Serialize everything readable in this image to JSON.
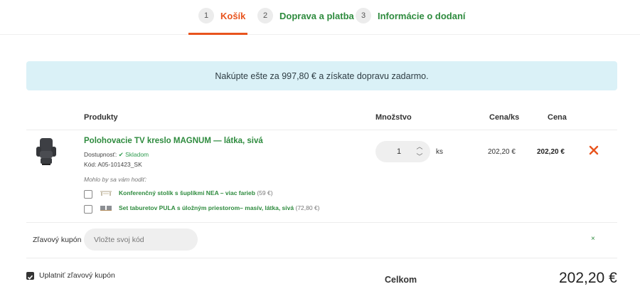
{
  "steps": [
    {
      "num": "1",
      "label": "Košík",
      "active": true
    },
    {
      "num": "2",
      "label": "Doprava a platba",
      "active": false
    },
    {
      "num": "3",
      "label": "Informácie o dodaní",
      "active": false
    }
  ],
  "banner": {
    "text": "Nakúpte ešte za 997,80 € a získate dopravu zadarmo."
  },
  "table": {
    "headers": {
      "products": "Produkty",
      "quantity": "Množstvo",
      "unit_price": "Cena/ks",
      "price": "Cena"
    }
  },
  "product": {
    "name": "Polohovacie TV kreslo MAGNUM — látka, sivá",
    "availability_label": "Dostupnosť:",
    "availability_value": "Skladom",
    "code": "Kód: A05-101423_SK",
    "quantity": "1",
    "unit": "ks",
    "unit_price": "202,20 €",
    "price": "202,20 €"
  },
  "suggestions": {
    "title": "Mohlo by sa vám hodiť:",
    "items": [
      {
        "name": "Konferenčný stolík s šuplíkmi NEA – viac farieb",
        "price": "(59 €)"
      },
      {
        "name": "Set taburetov PULA s úložným priestorom– masív, látka, sivá",
        "price": "(72,80 €)"
      }
    ]
  },
  "coupon": {
    "label": "Zľavový kupón",
    "placeholder": "Vložte svoj kód",
    "remove": "×"
  },
  "apply_coupon": {
    "label": "Uplatniť zľavový kupón",
    "checked": true
  },
  "total": {
    "label": "Celkom",
    "value": "202,20 €"
  },
  "colors": {
    "accent": "#e8541e",
    "green": "#2e8b3e",
    "banner_bg": "#daf1f7"
  }
}
